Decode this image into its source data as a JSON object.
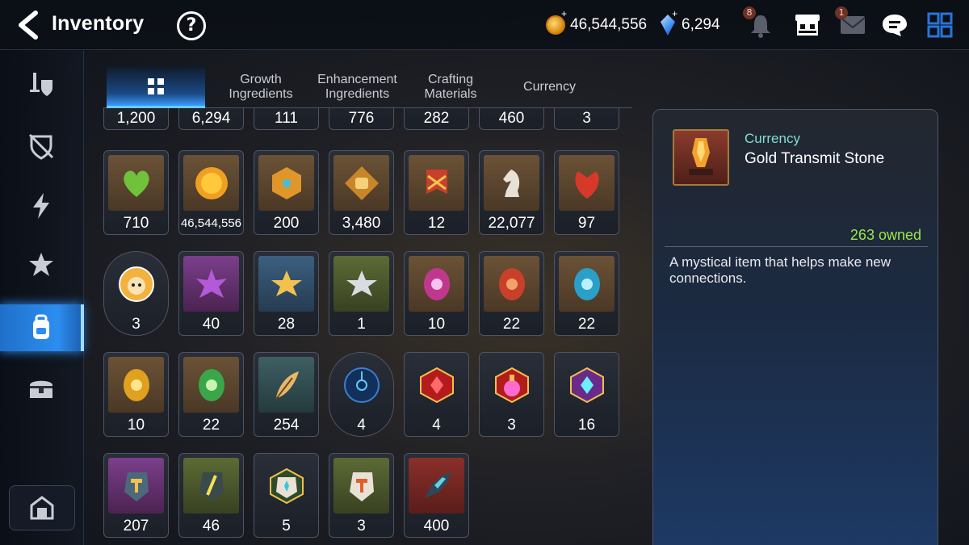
{
  "header": {
    "title": "Inventory",
    "help_label": "?",
    "gold": "46,544,556",
    "crystals": "6,294",
    "notification_badge": "8",
    "mail_badge": "1"
  },
  "tabs": [
    {
      "label": ""
    },
    {
      "label": "Growth Ingredients"
    },
    {
      "label": "Enhancement Ingredients"
    },
    {
      "label": "Crafting Materials"
    },
    {
      "label": "Currency"
    }
  ],
  "grid": {
    "row0": [
      "1,200",
      "6,294",
      "111",
      "776",
      "282",
      "460",
      "3"
    ],
    "row1": [
      "710",
      "46,544,556",
      "200",
      "3,480",
      "12",
      "22,077",
      "97"
    ],
    "row2": [
      "3",
      "40",
      "28",
      "1",
      "10",
      "22",
      "22"
    ],
    "row3": [
      "10",
      "22",
      "254",
      "4",
      "4",
      "3",
      "16"
    ],
    "row4": [
      "207",
      "46",
      "5",
      "3",
      "400"
    ]
  },
  "detail": {
    "category": "Currency",
    "name": "Gold Transmit Stone",
    "owned": "263 owned",
    "description": "A mystical item that helps make new connections."
  },
  "colors": {
    "accent": "#2c8ef0",
    "owned_green": "#9be64a",
    "category_teal": "#7fe0d6"
  }
}
